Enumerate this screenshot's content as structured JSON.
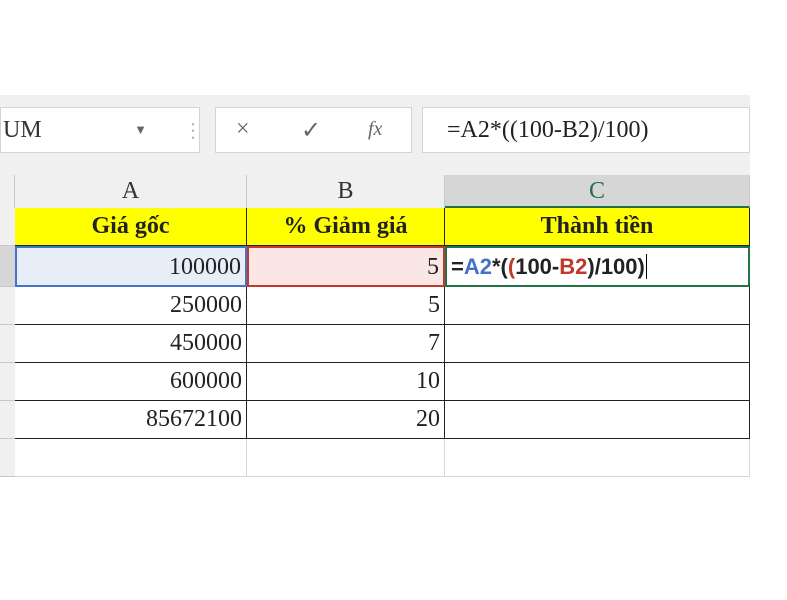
{
  "name_box": "UM",
  "formula_bar": {
    "cancel_icon": "×",
    "enter_icon": "✓",
    "fx_label": "fx",
    "value": "=A2*((100-B2)/100)"
  },
  "columns": [
    "A",
    "B",
    "C"
  ],
  "headers": [
    "Giá gốc",
    "% Giảm giá",
    "Thành tiền"
  ],
  "rows": [
    [
      "100000",
      "5"
    ],
    [
      "250000",
      "5"
    ],
    [
      "450000",
      "7"
    ],
    [
      "600000",
      "10"
    ],
    [
      "85672100",
      "20"
    ]
  ],
  "edit_formula": {
    "p1": "=",
    "p2": "A2",
    "p3": "*(",
    "p4": "(",
    "p5": "100-",
    "p6": "B2",
    "p7": ")/100)"
  },
  "colors": {
    "ref_a": "#4472c4",
    "ref_b": "#c0392b",
    "selected": "#217346",
    "header_fill": "#ffff00"
  }
}
